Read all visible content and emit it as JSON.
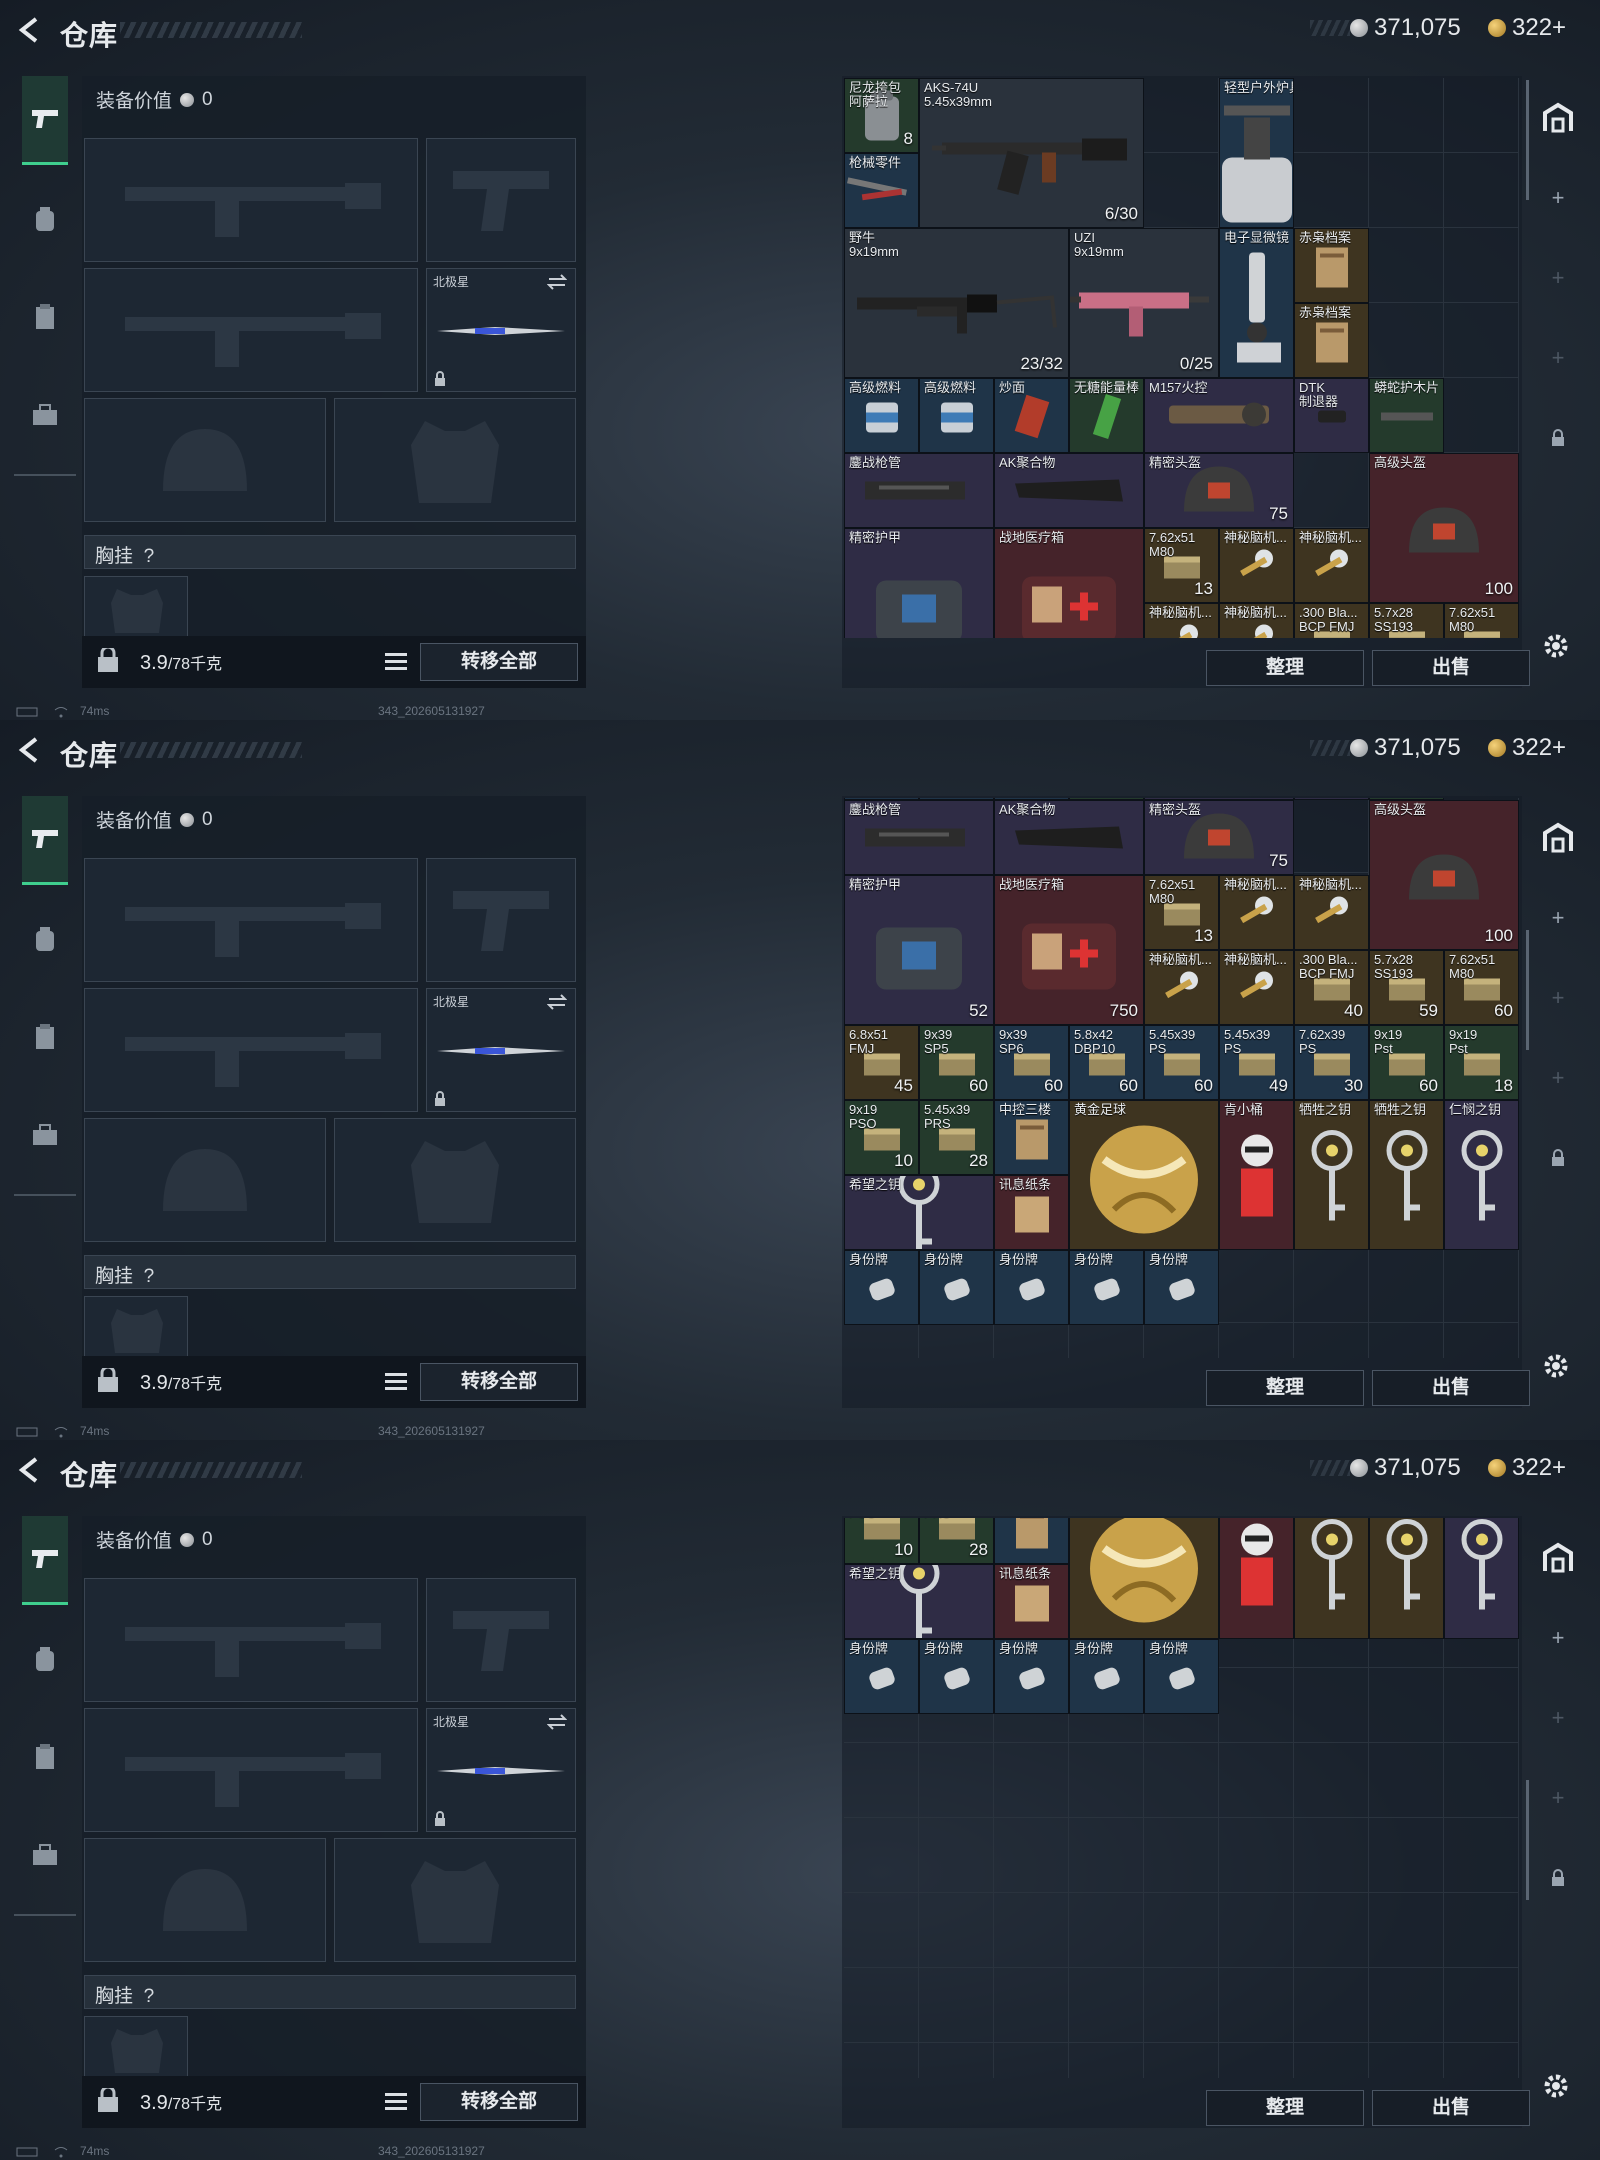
{
  "header": {
    "title": "仓库",
    "silver": "371,075",
    "gold": "322+"
  },
  "equip": {
    "value_label": "装备价值",
    "value": "0",
    "knife_slot_label": "北极星",
    "chest_label": "胸挂",
    "chest_help": "?",
    "weight_value": "3.9",
    "weight_unit": "/78千克",
    "transfer_label": "转移全部"
  },
  "stash": {
    "sort_label": "整理",
    "sell_label": "出售"
  },
  "status": {
    "latency": "74ms",
    "build": "343_202605131927"
  },
  "colors": {
    "accent": "#3fcf8e",
    "green": "#243a2c",
    "blue": "#1f3448",
    "purple": "#2f2c45",
    "gold": "#3e3420",
    "red": "#45232a"
  },
  "items": [
    {
      "id": "nylon",
      "name": "尼龙挎包\n阿萨拉",
      "count": "8",
      "rarity": "green",
      "icon": "bag-icon"
    },
    {
      "id": "aks",
      "name": "AKS-74U\n5.45x39mm",
      "count": "6/30",
      "rarity": "gray",
      "icon": "rifle-icon"
    },
    {
      "id": "stove",
      "name": "轻型户外炉具",
      "count": "",
      "rarity": "blue",
      "icon": "stove-icon"
    },
    {
      "id": "parts",
      "name": "枪械零件",
      "count": "",
      "rarity": "blue",
      "icon": "parts-icon"
    },
    {
      "id": "bison",
      "name": "野牛\n9x19mm",
      "count": "23/32",
      "rarity": "gray",
      "icon": "smg-icon"
    },
    {
      "id": "uzi",
      "name": "UZI\n9x19mm",
      "count": "0/25",
      "rarity": "gray",
      "icon": "uzi-icon"
    },
    {
      "id": "micro",
      "name": "电子显微镜",
      "count": "",
      "rarity": "blue",
      "icon": "microscope-icon"
    },
    {
      "id": "file1",
      "name": "赤枭档案",
      "count": "",
      "rarity": "gold",
      "icon": "file-icon"
    },
    {
      "id": "file2",
      "name": "赤枭档案",
      "count": "",
      "rarity": "gold",
      "icon": "file-icon"
    },
    {
      "id": "fuel1",
      "name": "高级燃料",
      "count": "",
      "rarity": "blue",
      "icon": "fuel-icon"
    },
    {
      "id": "fuel2",
      "name": "高级燃料",
      "count": "",
      "rarity": "blue",
      "icon": "fuel-icon"
    },
    {
      "id": "noodle",
      "name": "炒面",
      "count": "",
      "rarity": "blue",
      "icon": "food-icon"
    },
    {
      "id": "bar",
      "name": "无糖能量棒",
      "count": "",
      "rarity": "green",
      "icon": "bar-icon"
    },
    {
      "id": "m157",
      "name": "M157火控",
      "count": "",
      "rarity": "purple",
      "icon": "scope-icon"
    },
    {
      "id": "dtk",
      "name": "DTK\n制退器",
      "count": "",
      "rarity": "purple",
      "icon": "muzzle-icon"
    },
    {
      "id": "snake",
      "name": "蟒蛇护木片",
      "count": "",
      "rarity": "green",
      "icon": "rail-icon"
    },
    {
      "id": "guard",
      "name": "鏖战枪管",
      "count": "",
      "rarity": "purple",
      "icon": "barrel-icon"
    },
    {
      "id": "akpoly",
      "name": "AK聚合物",
      "count": "",
      "rarity": "purple",
      "icon": "stock-icon"
    },
    {
      "id": "helmet1",
      "name": "精密头盔",
      "count": "75",
      "rarity": "purple",
      "icon": "helmet-icon"
    },
    {
      "id": "helmet2",
      "name": "高级头盔",
      "count": "100",
      "rarity": "red",
      "icon": "helmet-icon"
    },
    {
      "id": "armor",
      "name": "精密护甲",
      "count": "52",
      "rarity": "purple",
      "icon": "armor-icon"
    },
    {
      "id": "medkit",
      "name": "战地医疗箱",
      "count": "750",
      "rarity": "red",
      "icon": "medkit-icon"
    },
    {
      "id": "a762m80",
      "name": "7.62x51\nM80",
      "count": "13",
      "rarity": "gold",
      "icon": "ammo-icon"
    },
    {
      "id": "gel1",
      "name": "神秘脑机...",
      "count": "",
      "rarity": "gold",
      "icon": "device-icon"
    },
    {
      "id": "gel2",
      "name": "神秘脑机...",
      "count": "",
      "rarity": "gold",
      "icon": "device-icon"
    },
    {
      "id": "gel3",
      "name": "神秘脑机...",
      "count": "",
      "rarity": "gold",
      "icon": "device-icon"
    },
    {
      "id": "gel4",
      "name": "神秘脑机...",
      "count": "",
      "rarity": "gold",
      "icon": "device-icon"
    },
    {
      "id": "a300",
      "name": ".300 Bla...\nBCP FMJ",
      "count": "40",
      "rarity": "gold",
      "icon": "ammo-icon"
    },
    {
      "id": "a57",
      "name": "5.7x28\nSS193",
      "count": "59",
      "rarity": "gold",
      "icon": "ammo-icon"
    },
    {
      "id": "a762b",
      "name": "7.62x51\nM80",
      "count": "60",
      "rarity": "gold",
      "icon": "ammo-icon"
    },
    {
      "id": "a68",
      "name": "6.8x51\nFMJ",
      "count": "45",
      "rarity": "gold",
      "icon": "ammo-icon"
    },
    {
      "id": "a919sp",
      "name": "9x39\nSP5",
      "count": "60",
      "rarity": "green",
      "icon": "ammo-icon"
    },
    {
      "id": "a919sp2",
      "name": "9x39\nSP6",
      "count": "60",
      "rarity": "blue",
      "icon": "ammo-icon"
    },
    {
      "id": "a58",
      "name": "5.8x42\nDBP10",
      "count": "60",
      "rarity": "blue",
      "icon": "ammo-icon"
    },
    {
      "id": "a545a",
      "name": "5.45x39\nPS",
      "count": "60",
      "rarity": "blue",
      "icon": "ammo-icon"
    },
    {
      "id": "a545b",
      "name": "5.45x39\nPS",
      "count": "49",
      "rarity": "blue",
      "icon": "ammo-icon"
    },
    {
      "id": "a762c",
      "name": "7.62x39\nPS",
      "count": "30",
      "rarity": "blue",
      "icon": "ammo-icon"
    },
    {
      "id": "a919a",
      "name": "9x19\nPst",
      "count": "60",
      "rarity": "green",
      "icon": "ammo-icon"
    },
    {
      "id": "a919b",
      "name": "9x19\nPst",
      "count": "18",
      "rarity": "green",
      "icon": "ammo-icon"
    },
    {
      "id": "a919c",
      "name": "9x19\nPSO",
      "count": "10",
      "rarity": "green",
      "icon": "ammo-icon"
    },
    {
      "id": "a545c",
      "name": "5.45x39\nPRS",
      "count": "28",
      "rarity": "green",
      "icon": "ammo-icon"
    },
    {
      "id": "fileb",
      "name": "中控三楼",
      "count": "",
      "rarity": "blue",
      "icon": "file-icon"
    },
    {
      "id": "ball",
      "name": "黄金足球",
      "count": "",
      "rarity": "gold",
      "icon": "ball-icon"
    },
    {
      "id": "bucket",
      "name": "肯小桶",
      "count": "",
      "rarity": "red",
      "icon": "figure-icon"
    },
    {
      "id": "key1",
      "name": "牺牲之钥",
      "count": "",
      "rarity": "gold",
      "icon": "key-icon"
    },
    {
      "id": "key2",
      "name": "牺牲之钥",
      "count": "",
      "rarity": "gold",
      "icon": "key-icon"
    },
    {
      "id": "key3",
      "name": "仁悯之钥",
      "count": "",
      "rarity": "purple",
      "icon": "key-icon"
    },
    {
      "id": "hope",
      "name": "希望之钥",
      "count": "",
      "rarity": "purple",
      "icon": "key-icon"
    },
    {
      "id": "note",
      "name": "讯息纸条",
      "count": "",
      "rarity": "red",
      "icon": "note-icon"
    },
    {
      "id": "tag1",
      "name": "身份牌",
      "count": "",
      "rarity": "blue",
      "icon": "tag-icon"
    },
    {
      "id": "tag2",
      "name": "身份牌",
      "count": "",
      "rarity": "blue",
      "icon": "tag-icon"
    },
    {
      "id": "tag3",
      "name": "身份牌",
      "count": "",
      "rarity": "blue",
      "icon": "tag-icon"
    },
    {
      "id": "tag4",
      "name": "身份牌",
      "count": "",
      "rarity": "blue",
      "icon": "tag-icon"
    },
    {
      "id": "tag5",
      "name": "身份牌",
      "count": "",
      "rarity": "blue",
      "icon": "tag-icon"
    }
  ]
}
